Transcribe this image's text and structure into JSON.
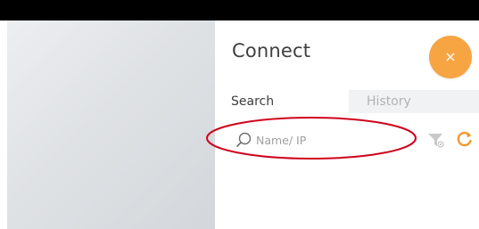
{
  "dialog": {
    "title": "Connect",
    "close_label": "×"
  },
  "tabs": [
    {
      "label": "Search",
      "active": true
    },
    {
      "label": "History",
      "active": false
    }
  ],
  "search": {
    "value": "",
    "placeholder": "Name/ IP"
  },
  "icons": {
    "search": "search-icon",
    "filter": "filter-icon",
    "refresh": "refresh-icon",
    "close": "close-icon"
  },
  "colors": {
    "accent": "#f7a543",
    "annotation": "#d0021b",
    "title_text": "#3f3f3f",
    "inactive_tab_bg": "#f1f2f3"
  }
}
